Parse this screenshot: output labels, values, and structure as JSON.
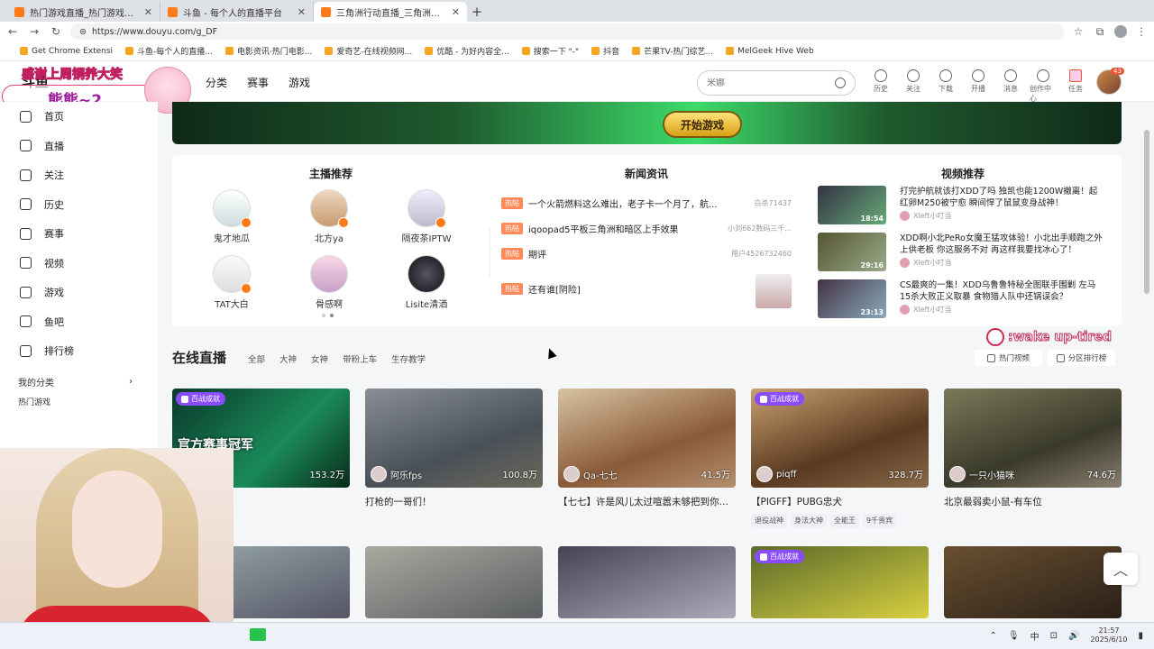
{
  "browser": {
    "tabs": [
      {
        "title": "热门游戏直播_热门游戏视频_热",
        "active": false
      },
      {
        "title": "斗鱼 - 每个人的直播平台",
        "active": false
      },
      {
        "title": "三角洲行动直播_三角洲行动直播间",
        "active": true
      }
    ],
    "url": "https://www.douyu.com/g_DF",
    "bookmarks": [
      "Get Chrome Extensi",
      "斗鱼-每个人的直播...",
      "电影资讯·热门电影...",
      "爱奇艺-在线视频网...",
      "优酷 - 为好内容全...",
      "搜索一下 \"-\"",
      "抖音",
      "芒果TV-热门综艺...",
      "MelGeek Hive Web"
    ]
  },
  "overlay": {
    "line1": "感谢上周铜养大笑",
    "line2": "熊熊~2",
    "wake": ":wake up-tired"
  },
  "header": {
    "logo": "斗鱼",
    "nav": [
      "分类",
      "赛事",
      "游戏"
    ],
    "search_placeholder": "米娜",
    "icons": [
      {
        "label": "历史",
        "icon": "history-icon"
      },
      {
        "label": "关注",
        "icon": "heart-icon"
      },
      {
        "label": "下载",
        "icon": "download-icon"
      },
      {
        "label": "开播",
        "icon": "broadcast-icon"
      },
      {
        "label": "消息",
        "icon": "bell-icon"
      },
      {
        "label": "创作中心",
        "icon": "bulb-icon"
      },
      {
        "label": "任务",
        "icon": "gift-icon"
      }
    ],
    "avatar_badge": "43"
  },
  "sidebar": {
    "items": [
      "首页",
      "直播",
      "关注",
      "历史",
      "赛事",
      "视频",
      "游戏",
      "鱼吧",
      "排行榜"
    ],
    "my_category": "我的分类",
    "hot_games": "热门游戏"
  },
  "banner": {
    "cta": "开始游戏"
  },
  "recommend": {
    "streamers_title": "主播推荐",
    "streamers": [
      "鬼才地瓜",
      "北方ya",
      "隔夜茶IPTW",
      "TAT大白",
      "骨感啊",
      "Lisite清洒"
    ],
    "news_title": "新闻资讯",
    "news": [
      {
        "tag": "热帖",
        "title": "一个火箭燃料这么难出，老子卡一个月了，航...",
        "author": "白杀71437"
      },
      {
        "tag": "热帖",
        "title": "iqoopad5平板三角洲和暗区上手效果",
        "author": "小刘662数码三千..."
      },
      {
        "tag": "热帖",
        "title": "期评",
        "author": "用户4526732460"
      },
      {
        "tag": "热帖",
        "title": "还有谁[阴险]",
        "author": ""
      }
    ],
    "video_title": "视频推荐",
    "videos": [
      {
        "title": "打完护航就该打XDD了吗 独凯也能1200W撤离！起红卵M250被宁愈 瞬间悍了鼠鼠变身战神！",
        "author": "Xleft小叮当",
        "duration": "18:54"
      },
      {
        "title": "XDD啊小北PeRo女魔王猛攻体验！小北出手顺跑之外上供老板 你这服务不对 再这样我要找冰心了！",
        "author": "Xleft小叮当",
        "duration": "29:16"
      },
      {
        "title": "CS最爽的一集！XDD乌鲁鲁特秘全图联手围剿 左马15杀大败正义取暴 食物猎人队中还锅误会？",
        "author": "Xleft小叮当",
        "duration": "23:13"
      }
    ]
  },
  "live": {
    "title": "在线直播",
    "tabs": [
      "全部",
      "大神",
      "女神",
      "带粉上车",
      "生存教学"
    ],
    "side_buttons": [
      "热门视频",
      "分区排行榜"
    ],
    "cards": [
      {
        "badge": "百战成就",
        "user": "",
        "viewers": "153.2万",
        "title": "",
        "tags": [],
        "overlay_text": "官方赛事冠军"
      },
      {
        "badge": "",
        "user": "阿乐fps",
        "viewers": "100.8万",
        "title": "打枪的一哥们！",
        "tags": []
      },
      {
        "badge": "",
        "user": "Qa-七七",
        "viewers": "41.5万",
        "title": "【七七】许是风儿太过喧嚣未够把到你的...",
        "tags": []
      },
      {
        "badge": "百战成就",
        "user": "piqff",
        "viewers": "328.7万",
        "title": "【PIGFF】PUBG忠犬",
        "tags": [
          "退役战神",
          "身法大神",
          "全能王",
          "9千贵宾"
        ]
      },
      {
        "badge": "",
        "user": "一只小猫咪",
        "viewers": "74.6万",
        "title": "北京最弱卖小鼠-有车位",
        "tags": []
      },
      {
        "badge": "百战成就",
        "user": "",
        "viewers": "",
        "title": "",
        "tags": []
      }
    ]
  },
  "taskbar": {
    "time": "21:57",
    "date": "2025/6/10",
    "ime": "中"
  }
}
